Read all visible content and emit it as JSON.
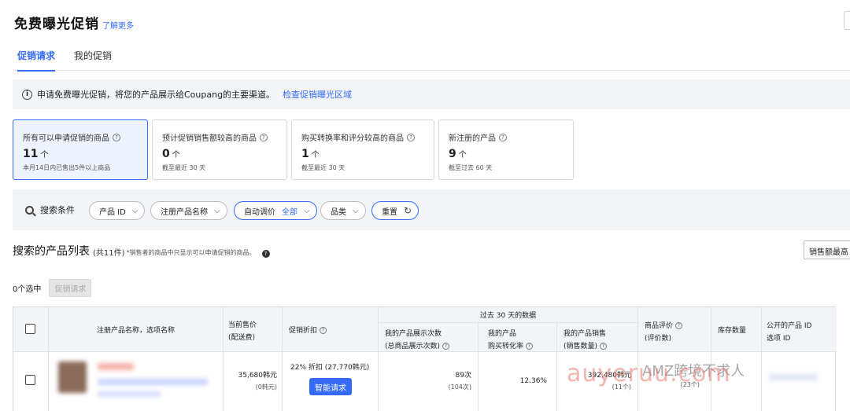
{
  "header": {
    "title": "免费曝光促销",
    "learn_more": "了解更多"
  },
  "tabs": [
    {
      "label": "促销请求"
    },
    {
      "label": "我的促销"
    }
  ],
  "notice": {
    "text": "申请免费曝光促销，将您的产品展示给Coupang的主要渠道。",
    "link": "检查促销曝光区域"
  },
  "cards": [
    {
      "title": "所有可以申请促销的商品",
      "count": "11",
      "unit": "个",
      "sub": "本月14日内已售出5件以上商品"
    },
    {
      "title": "预计促销销售额较高的商品",
      "count": "0",
      "unit": "个",
      "sub": "截至最近 30 天"
    },
    {
      "title": "购买转换率和评分较高的商品",
      "count": "1",
      "unit": "个",
      "sub": "截至最近 30 天"
    },
    {
      "title": "新注册的产品",
      "count": "9",
      "unit": "个",
      "sub": "截至过去 60 天"
    }
  ],
  "filters": {
    "label": "搜索条件",
    "product_id": "产品 ID",
    "product_name": "注册产品名称",
    "auto_price": "自动调价",
    "auto_price_value": "全部",
    "category": "品类",
    "reset": "重置"
  },
  "list": {
    "title": "搜索的产品列表",
    "count": "(共11件)",
    "note": "*销售者的商品中只显示可以申请促销的商品。",
    "sort": "销售额最高"
  },
  "selection": {
    "selected": "0个选中",
    "promo_request": "促销请求"
  },
  "table": {
    "group_header": "过去 30 天的数据",
    "headers": {
      "product_name": "注册产品名称，选项名称",
      "current_price_1": "当前售价",
      "current_price_2": "(配送费)",
      "discount": "促销折扣",
      "impressions_1": "我的产品展示次数",
      "impressions_2": "(总商品展示次数)",
      "conversion_1": "我的产品",
      "conversion_2": "购买转化率",
      "sales_1": "我的产品销售",
      "sales_2": "(销售数量)",
      "rating_1": "商品评价",
      "rating_2": "(评价数)",
      "stock": "库存数量",
      "public_id_1": "公开的产品 ID",
      "public_id_2": "选项 ID"
    },
    "rows": [
      {
        "price": "35,680韩元",
        "shipping": "(0韩元)",
        "discount": "22% 折扣 (27,770韩元)",
        "smart_request": "智能请求",
        "impressions": "89次",
        "total_impressions": "(104次)",
        "conversion": "12.36%",
        "sales": "392,480韩元",
        "sales_qty": "(11个)",
        "rating_count": "(23个)"
      }
    ]
  },
  "watermark": {
    "top": "AMZ跨境不求人",
    "bottom": "auyeruu.com"
  },
  "colors": {
    "accent": "#346aff",
    "panel": "#f3f4f6"
  }
}
